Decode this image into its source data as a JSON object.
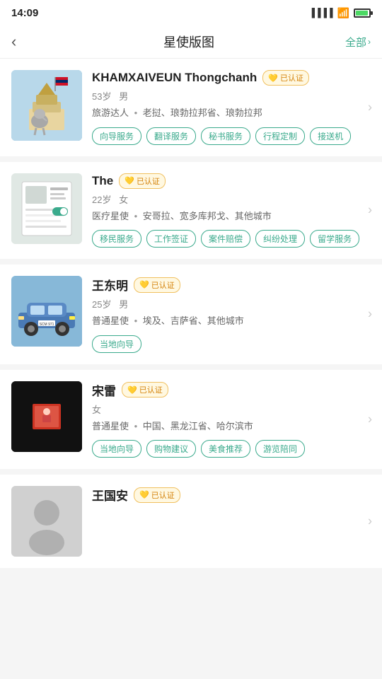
{
  "statusBar": {
    "time": "14:09"
  },
  "header": {
    "backLabel": "‹",
    "title": "星使版图",
    "rightLabel": "全部",
    "rightChevron": "›"
  },
  "cards": [
    {
      "id": "card-1",
      "name": "KHAMXAIVEUN Thongchanh",
      "verified": "已认证",
      "age": "53岁",
      "gender": "男",
      "role": "旅游达人",
      "location": "老挝、琅勃拉邦省、琅勃拉邦",
      "tags": [
        "向导服务",
        "翻译服务",
        "秘书服务",
        "行程定制",
        "接送机"
      ],
      "avatarType": "laos"
    },
    {
      "id": "card-2",
      "name": "The",
      "verified": "已认证",
      "age": "22岁",
      "gender": "女",
      "role": "医疗星使",
      "location": "安哥拉、宽多库邦戈、其他城市",
      "tags": [
        "移民服务",
        "工作签证",
        "案件赔偿",
        "纠纷处理",
        "留学服务"
      ],
      "avatarType": "document"
    },
    {
      "id": "card-3",
      "name": "王东明",
      "verified": "已认证",
      "age": "25岁",
      "gender": "男",
      "role": "普通星使",
      "location": "埃及、吉萨省、其他城市",
      "tags": [
        "当地向导"
      ],
      "avatarType": "car"
    },
    {
      "id": "card-4",
      "name": "宋雷",
      "verified": "已认证",
      "age": "",
      "gender": "女",
      "role": "普通星使",
      "location": "中国、黑龙江省、哈尔滨市",
      "tags": [
        "当地向导",
        "购物建议",
        "美食推荐",
        "游览陪同"
      ],
      "avatarType": "black"
    },
    {
      "id": "card-5",
      "name": "王国安",
      "verified": "已认证",
      "age": "",
      "gender": "",
      "role": "",
      "location": "",
      "tags": [],
      "avatarType": "gray"
    }
  ],
  "verified_label": "已认证",
  "separator": "•"
}
